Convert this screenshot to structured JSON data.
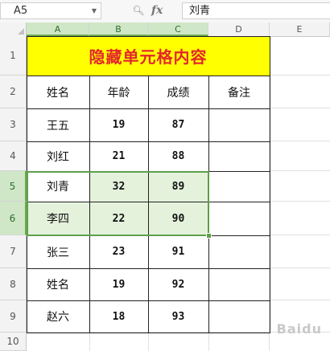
{
  "formula_bar": {
    "name_box": "A5",
    "fx_label": "fx",
    "value": "刘青"
  },
  "columns": [
    "A",
    "B",
    "C",
    "D",
    "E"
  ],
  "rows": [
    "1",
    "2",
    "3",
    "4",
    "5",
    "6",
    "7",
    "8",
    "9",
    "10"
  ],
  "sheet": {
    "title": "隐藏单元格内容",
    "headers": [
      "姓名",
      "年龄",
      "成绩",
      "备注"
    ],
    "records": [
      {
        "name": "王五",
        "age": "19",
        "score": "87"
      },
      {
        "name": "刘红",
        "age": "21",
        "score": "88"
      },
      {
        "name": "刘青",
        "age": "32",
        "score": "89"
      },
      {
        "name": "李四",
        "age": "22",
        "score": "90"
      },
      {
        "name": "张三",
        "age": "23",
        "score": "91"
      },
      {
        "name": "姓名",
        "age": "19",
        "score": "92"
      },
      {
        "name": "赵六",
        "age": "18",
        "score": "93"
      }
    ]
  },
  "selection": {
    "range": "A5:C6"
  },
  "colors": {
    "title_bg": "#ffff00",
    "title_text": "#e3262b",
    "selection": "#5f9f4a"
  }
}
